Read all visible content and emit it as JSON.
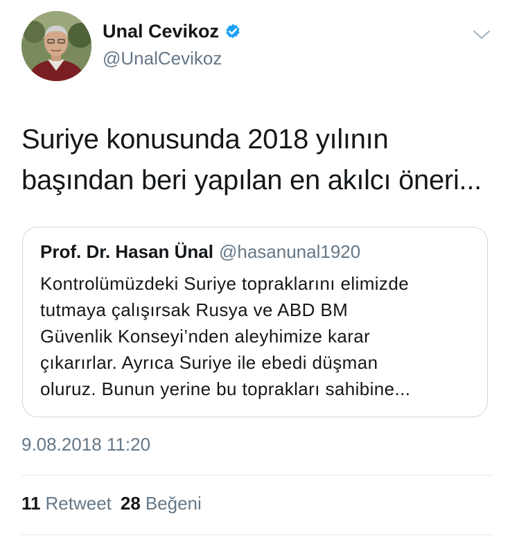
{
  "author": {
    "name": "Unal Cevikoz",
    "handle": "@UnalCevikoz",
    "verified_icon": "verified-badge-icon",
    "avatar": "avatar-photo"
  },
  "menu_icon": "chevron-down-icon",
  "tweet": {
    "text_line1": "Suriye konusunda 2018 yılının",
    "text_line2": "başından beri yapılan en akılcı öneri..."
  },
  "quoted_tweet": {
    "name": "Prof. Dr. Hasan Ünal",
    "handle": "@hasanunal1920",
    "lines": [
      "Kontrolümüzdeki Suriye topraklarını elimizde",
      "tutmaya çalışırsak Rusya ve ABD BM",
      "Güvenlik Konseyi’nden aleyhimize karar",
      "çıkarırlar. Ayrıca Suriye ile ebedi düşman",
      "oluruz. Bunun yerine bu toprakları sahibine..."
    ]
  },
  "timestamp": "9.08.2018 11:20",
  "stats": {
    "retweets_count": "11",
    "retweets_label": "Retweet",
    "likes_count": "28",
    "likes_label": "Beğeni"
  },
  "colors": {
    "text": "#14171a",
    "secondary": "#657786",
    "verified": "#1da1f2",
    "border": "#ccd6dd",
    "divider": "#e1e8ed"
  }
}
